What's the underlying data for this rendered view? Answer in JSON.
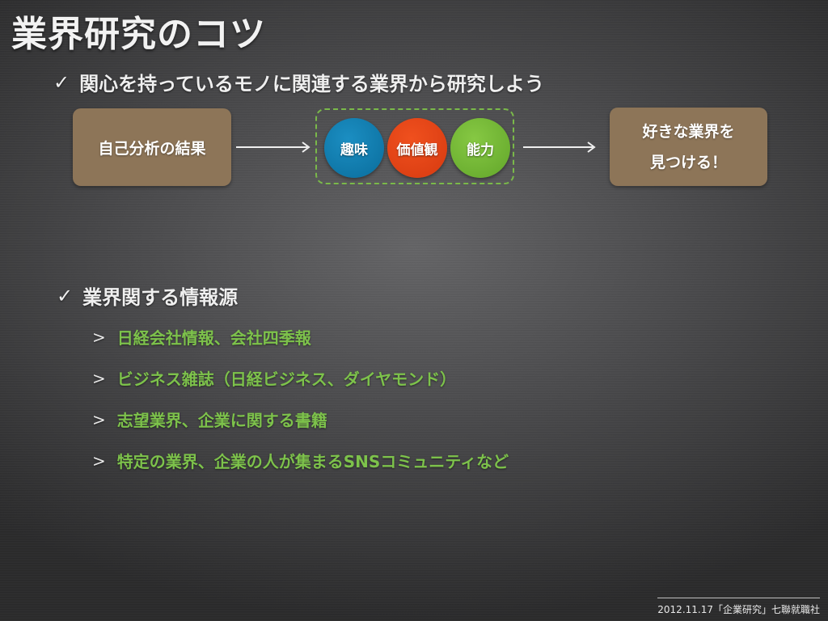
{
  "slide": {
    "title": "業界研究のコツ",
    "check_icon": "checkmark-icon",
    "point1": "関心を持っているモノに関連する業界から研究しよう",
    "flow": {
      "start_box": "自己分析の結果",
      "circles": [
        "趣味",
        "価値観",
        "能力"
      ],
      "circle_colors": [
        "#0f7fb2",
        "#e8461a",
        "#75b83a"
      ],
      "end_box_line1": "好きな業界を",
      "end_box_line2": "見つける！"
    },
    "point2": "業界関する情報源",
    "chevron_icon": "chevron-right-icon",
    "sources": [
      "日経会社情報、会社四季報",
      "ビジネス雑誌（日経ビジネス、ダイヤモンド）",
      "志望業界、企業に関する書籍",
      "特定の業界、企業の人が集まるSNSコミュニティなど"
    ],
    "footer": "2012.11.17「企業研究」七聯就職社"
  }
}
